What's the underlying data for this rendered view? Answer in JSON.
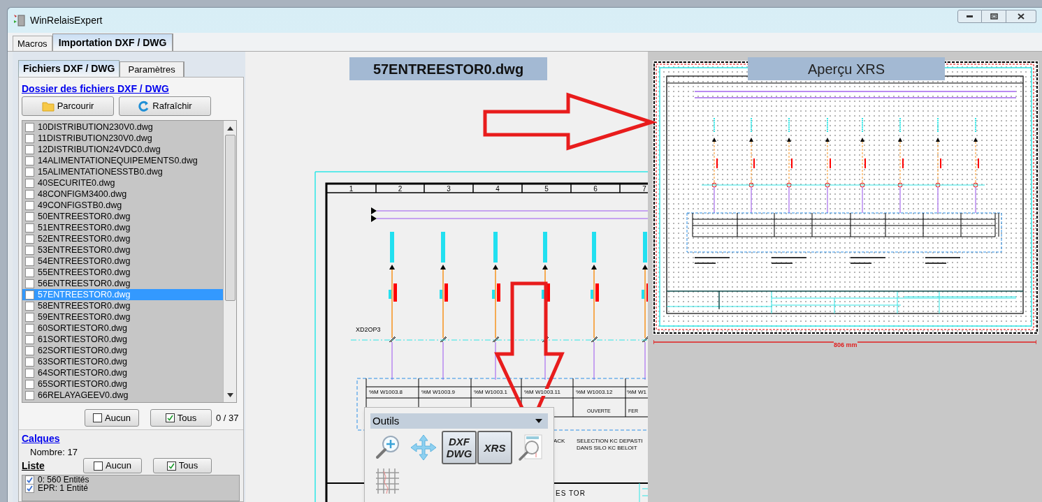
{
  "window": {
    "title": "WinRelaisExpert"
  },
  "tabs": [
    {
      "label": "Macros",
      "selected": false
    },
    {
      "label": "Importation DXF / DWG",
      "selected": true
    }
  ],
  "left_panel": {
    "tabs": [
      {
        "label": "Fichiers DXF / DWG",
        "selected": true
      },
      {
        "label": "Paramètres",
        "selected": false
      }
    ],
    "folder_link": "Dossier des fichiers DXF / DWG",
    "buttons": [
      {
        "label": "Parcourir",
        "kind": "folder"
      },
      {
        "label": "Rafraîchir",
        "kind": "refresh"
      }
    ],
    "files": [
      {
        "name": "10DISTRIBUTION230V0.dwg",
        "checked": false,
        "selected": false
      },
      {
        "name": "11DISTRIBUTION230V0.dwg",
        "checked": false,
        "selected": false
      },
      {
        "name": "12DISTRIBUTION24VDC0.dwg",
        "checked": false,
        "selected": false
      },
      {
        "name": "14ALIMENTATIONEQUIPEMENTS0.dwg",
        "checked": false,
        "selected": false
      },
      {
        "name": "15ALIMENTATIONESSTB0.dwg",
        "checked": false,
        "selected": false
      },
      {
        "name": "40SECURITE0.dwg",
        "checked": false,
        "selected": false
      },
      {
        "name": "48CONFIGM3400.dwg",
        "checked": false,
        "selected": false
      },
      {
        "name": "49CONFIGSTB0.dwg",
        "checked": false,
        "selected": false
      },
      {
        "name": "50ENTREESTOR0.dwg",
        "checked": false,
        "selected": false
      },
      {
        "name": "51ENTREESTOR0.dwg",
        "checked": false,
        "selected": false
      },
      {
        "name": "52ENTREESTOR0.dwg",
        "checked": false,
        "selected": false
      },
      {
        "name": "53ENTREESTOR0.dwg",
        "checked": false,
        "selected": false
      },
      {
        "name": "54ENTREESTOR0.dwg",
        "checked": false,
        "selected": false
      },
      {
        "name": "55ENTREESTOR0.dwg",
        "checked": false,
        "selected": false
      },
      {
        "name": "56ENTREESTOR0.dwg",
        "checked": false,
        "selected": false
      },
      {
        "name": "57ENTREESTOR0.dwg",
        "checked": false,
        "selected": true
      },
      {
        "name": "58ENTREESTOR0.dwg",
        "checked": false,
        "selected": false
      },
      {
        "name": "59ENTREESTOR0.dwg",
        "checked": false,
        "selected": false
      },
      {
        "name": "60SORTIESTOR0.dwg",
        "checked": false,
        "selected": false
      },
      {
        "name": "61SORTIESTOR0.dwg",
        "checked": false,
        "selected": false
      },
      {
        "name": "62SORTIESTOR0.dwg",
        "checked": false,
        "selected": false
      },
      {
        "name": "63SORTIESTOR0.dwg",
        "checked": false,
        "selected": false
      },
      {
        "name": "64SORTIESTOR0.dwg",
        "checked": false,
        "selected": false
      },
      {
        "name": "65SORTIESTOR0.dwg",
        "checked": false,
        "selected": false
      },
      {
        "name": "66RELAYAGEEV0.dwg",
        "checked": false,
        "selected": false
      }
    ],
    "file_buttons": [
      {
        "label": "Aucun",
        "kind": "none"
      },
      {
        "label": "Tous",
        "kind": "all"
      }
    ],
    "file_count": "0 / 37",
    "layers": {
      "title": "Calques",
      "count": "Nombre: 17",
      "list_label": "Liste",
      "buttons": [
        {
          "label": "Aucun",
          "kind": "none"
        },
        {
          "label": "Tous",
          "kind": "all"
        }
      ],
      "items": [
        {
          "name": "0: 560 Entités",
          "checked": true
        },
        {
          "name": "EPR: 1 Entité",
          "checked": true
        }
      ]
    }
  },
  "drawing": {
    "file_label": "57ENTREESTOR0.dwg",
    "columns": [
      "1",
      "2",
      "3",
      "4",
      "5",
      "6",
      "7"
    ],
    "junction_label": "XD2OP3",
    "addresses": [
      "%M W1003.8",
      "%M W1003.9",
      "%M W1003.1",
      "%M W1003.11",
      "%M W1003.12",
      "%M W1"
    ],
    "states": [
      "OUVERTE",
      "FER"
    ],
    "notes": [
      "ACK",
      "SELECTION KC DEPASTI",
      "DANS SILO KC BELOIT"
    ],
    "title_block": "ES TOR"
  },
  "tools": {
    "title": "Outils",
    "buttons": [
      {
        "kind": "zoom",
        "selected": false
      },
      {
        "kind": "pan",
        "selected": false
      },
      {
        "kind": "text",
        "lines": [
          "DXF",
          "DWG"
        ],
        "selected": true
      },
      {
        "kind": "text",
        "lines": [
          "XRS"
        ],
        "selected": true
      },
      {
        "kind": "preview",
        "selected": false
      },
      {
        "kind": "grid",
        "selected": false
      }
    ]
  },
  "preview": {
    "title": "Aperçu XRS",
    "width_label": "806 mm"
  }
}
